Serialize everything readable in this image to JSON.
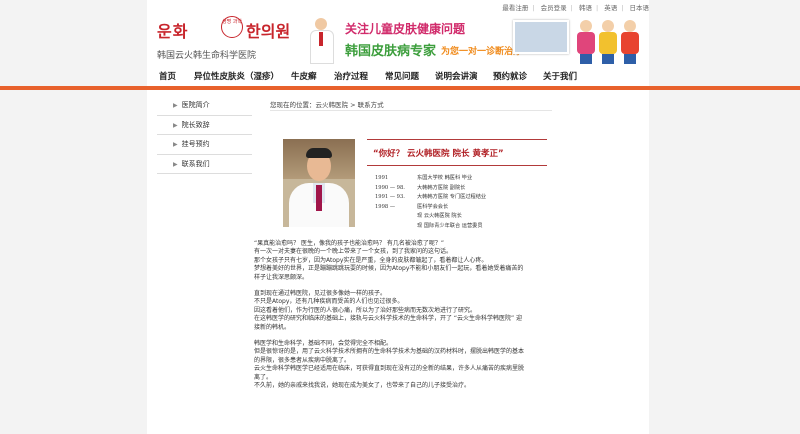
{
  "toplinks": [
    "最看注册",
    "会员登录",
    "韩语",
    "英语",
    "日本语"
  ],
  "logo": {
    "kr_left": "운화",
    "seal": "생명 과학",
    "kr_right": "한의원",
    "cn": "韩国云火韩生命科学医院"
  },
  "banner": {
    "line1": "关注儿童皮肤健康问题",
    "line2": "韩国皮肤病专家",
    "line3": "为您一对一诊断治疗"
  },
  "nav": [
    "首页",
    "异位性皮肤炎（湿疹）",
    "牛皮癣",
    "治疗过程",
    "常见问题",
    "说明会讲演",
    "预约就诊",
    "关于我们"
  ],
  "sidebar": [
    "医院简介",
    "院长致辞",
    "挂号预约",
    "联系我们"
  ],
  "breadcrumb": "您现在的位置：云火韩医院 > 联系方式",
  "bio": {
    "title": "“你好？ 云火韩医院 院长 黄孝正”",
    "entries": [
      {
        "year": "1991",
        "text": "东国大学校 韩医科 毕业"
      },
      {
        "year": "1990 — 98.",
        "text": "大韩韩方医院 副院长"
      },
      {
        "year": "1991 — 93.",
        "text": "大韩韩方医院 专门医过程结业"
      },
      {
        "year": "1998 —",
        "text": "医科学会会长"
      },
      {
        "year": "",
        "text": "现 云火韩医院 院长"
      },
      {
        "year": "",
        "text": "现 国际青少年联合 运营委员"
      }
    ]
  },
  "body": [
    [
      "“果真能治愈吗？ 医生，像我的孩子也能治愈吗？ 有几名被治愈了呢？”",
      "有一次一对夫妻在很晚的一个晚上带来了一个女孩，到了我家问的这句话。",
      "那个女孩子只有七岁，因为Atopy实在是严重，全身的皮肤都皱起了，看着都让人心疼。",
      "梦想着美好的世界，正是蹦蹦跳跳玩耍的时候，因为Atopy不能和小朋友们一起玩，看着她受着痛苦的",
      "样子让我深思颇深。"
    ],
    [
      "直到现在通过韩医院，见过很多像她一样的孩子。",
      "不只是Atopy，还有几种疾病而受苦的人们也见过很多。",
      "因这看着他们，作为行医的人很心痛，所以为了治好那些病而无数次地进行了研究。",
      "在这韩医学的研究和临床的基础上，接轨与云火科学技术的生命科学，开了 “云火生命科学韩医院” 迎",
      "接新的韩机。"
    ],
    [
      "韩医学和生命科学，基础不同，会觉得完全不相配。",
      "但是很惊讶的是，用了云火科学技术所拥有的生命科学技术为基础的汉药材料时，摆脱出韩医学的基本",
      "的界限，很多患者从疾病中脱离了。",
      "云火生命科学韩医学已经适用在临床，可获得直到现在没有过的全新的结果，许多人从痛苦的疾病里脱",
      "离了。",
      "不久前，她的亲戚来找我说，她现在成为美女了，也带来了自己的儿子接受治疗。"
    ]
  ]
}
